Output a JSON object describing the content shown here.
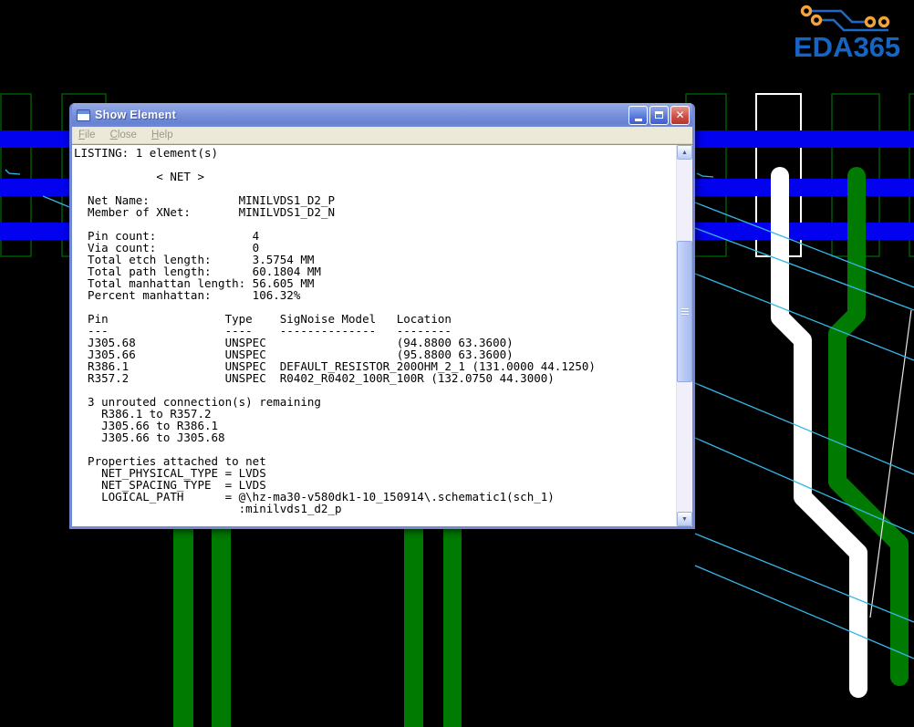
{
  "window": {
    "title": "Show Element",
    "menu": [
      {
        "label": "File"
      },
      {
        "label": "Close"
      },
      {
        "label": "Help"
      }
    ],
    "controls": {
      "close_glyph": "✕",
      "scroll_up_glyph": "▲",
      "scroll_down_glyph": "▼"
    }
  },
  "listing": {
    "lines": [
      "LISTING: 1 element(s)",
      "",
      "            < NET >",
      "",
      "  Net Name:             MINILVDS1_D2_P",
      "  Member of XNet:       MINILVDS1_D2_N",
      "",
      "  Pin count:              4",
      "  Via count:              0",
      "  Total etch length:      3.5754 MM",
      "  Total path length:      60.1804 MM",
      "  Total manhattan length: 56.605 MM",
      "  Percent manhattan:      106.32%",
      "",
      "  Pin                 Type    SigNoise Model   Location",
      "  ---                 ----    --------------   --------",
      "  J305.68             UNSPEC                   (94.8800 63.3600)",
      "  J305.66             UNSPEC                   (95.8800 63.3600)",
      "  R386.1              UNSPEC  DEFAULT_RESISTOR_200OHM_2_1 (131.0000 44.1250)",
      "  R357.2              UNSPEC  R0402_R0402_100R_100R (132.0750 44.3000)",
      "",
      "  3 unrouted connection(s) remaining",
      "    R386.1 to R357.2",
      "    J305.66 to R386.1",
      "    J305.66 to J305.68",
      "",
      "  Properties attached to net",
      "    NET_PHYSICAL_TYPE = LVDS",
      "    NET_SPACING_TYPE  = LVDS",
      "    LOGICAL_PATH      = @\\hz-ma30-v580dk1-10_150914\\.schematic1(sch_1)",
      "                        :minilvds1_d2_p"
    ]
  },
  "logo": {
    "text": "EDA365"
  },
  "colors": {
    "pcb_blue": "#0202EE",
    "pcb_green_fill": "#007A00",
    "pcb_green_outline": "#006600",
    "trace_white": "#FFFFFF",
    "ratsnest_cyan": "#35B6E8",
    "ratsnest_white": "#E8E8E8",
    "logo_blue": "#1B6AC9",
    "logo_orange": "#F2A33C"
  }
}
